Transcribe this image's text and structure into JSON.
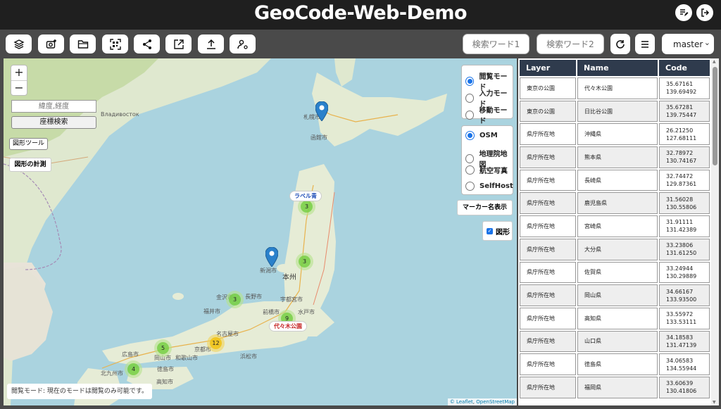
{
  "header": {
    "title": "GeoCode-Web-Demo",
    "icons": [
      "edit-note-icon",
      "logout-icon"
    ]
  },
  "toolbar": {
    "buttons": [
      "layers-icon",
      "add-photo-icon",
      "folder-open-icon",
      "qr-scan-icon",
      "share-icon",
      "open-external-icon",
      "upload-icon",
      "user-settings-icon"
    ],
    "search1_placeholder": "検索ワード1",
    "search2_placeholder": "検索ワード2",
    "refresh_icon": "refresh-icon",
    "list_icon": "list-icon",
    "branch_value": "master"
  },
  "map": {
    "zoom_in": "+",
    "zoom_out": "−",
    "coord_placeholder": "緯度,経度",
    "coord_search": "座標検索",
    "shape_tool": "図形ツール",
    "measure": "図形の計測",
    "modes": [
      {
        "label": "閲覧モード",
        "selected": true
      },
      {
        "label": "入力モード",
        "selected": false
      },
      {
        "label": "移動モード",
        "selected": false
      }
    ],
    "basemaps": [
      {
        "label": "OSM",
        "selected": true
      },
      {
        "label": "地理院地図",
        "selected": false
      },
      {
        "label": "航空写真",
        "selected": false
      },
      {
        "label": "SelfHost",
        "selected": false
      }
    ],
    "marker_names": "マーカー名表示",
    "shapes_checkbox": "図形",
    "clusters": [
      "3",
      "3",
      "3",
      "9",
      "12",
      "5",
      "4"
    ],
    "labels": {
      "blue": "ラベル青",
      "red": "代々木公園"
    },
    "places": {
      "honshu": "本州",
      "vladivostok": "Владивосток",
      "sapporo": "札幌市",
      "hakodate": "函館市",
      "niigata": "新潟市",
      "nagano": "長野市",
      "kanazawa": "金沢市",
      "fukui": "福井市",
      "nagoya": "名古屋市",
      "kyoto": "京都市",
      "hiroshima": "広島市",
      "okayama": "岡山市",
      "kochi": "高知市",
      "tokushima": "徳島市",
      "maebashi": "前橋市",
      "utsunomiya": "宇都宮市",
      "mito": "水戸市",
      "kitakyushu": "北九州市",
      "hamamatsu": "浜松市",
      "wakayama": "和歌山市"
    },
    "status": "閲覧モード: 現在のモードは閲覧のみ可能です。",
    "attribution_leaflet": "© Leaflet",
    "attribution_osm": "OpenStreetMap"
  },
  "table": {
    "headers": [
      "Layer",
      "Name",
      "Code"
    ],
    "rows": [
      {
        "layer": "東京の公園",
        "name": "代々木公園",
        "lat": "35.67161",
        "lon": "139.69492"
      },
      {
        "layer": "東京の公園",
        "name": "日比谷公園",
        "lat": "35.67281",
        "lon": "139.75447"
      },
      {
        "layer": "県庁所在地",
        "name": "沖縄県",
        "lat": "26.21250",
        "lon": "127.68111"
      },
      {
        "layer": "県庁所在地",
        "name": "熊本県",
        "lat": "32.78972",
        "lon": "130.74167"
      },
      {
        "layer": "県庁所在地",
        "name": "長崎県",
        "lat": "32.74472",
        "lon": "129.87361"
      },
      {
        "layer": "県庁所在地",
        "name": "鹿児島県",
        "lat": "31.56028",
        "lon": "130.55806"
      },
      {
        "layer": "県庁所在地",
        "name": "宮崎県",
        "lat": "31.91111",
        "lon": "131.42389"
      },
      {
        "layer": "県庁所在地",
        "name": "大分県",
        "lat": "33.23806",
        "lon": "131.61250"
      },
      {
        "layer": "県庁所在地",
        "name": "佐賀県",
        "lat": "33.24944",
        "lon": "130.29889"
      },
      {
        "layer": "県庁所在地",
        "name": "岡山県",
        "lat": "34.66167",
        "lon": "133.93500"
      },
      {
        "layer": "県庁所在地",
        "name": "高知県",
        "lat": "33.55972",
        "lon": "133.53111"
      },
      {
        "layer": "県庁所在地",
        "name": "山口県",
        "lat": "34.18583",
        "lon": "131.47139"
      },
      {
        "layer": "県庁所在地",
        "name": "徳島県",
        "lat": "34.06583",
        "lon": "134.55944"
      },
      {
        "layer": "県庁所在地",
        "name": "福岡県",
        "lat": "33.60639",
        "lon": "130.41806"
      }
    ]
  }
}
